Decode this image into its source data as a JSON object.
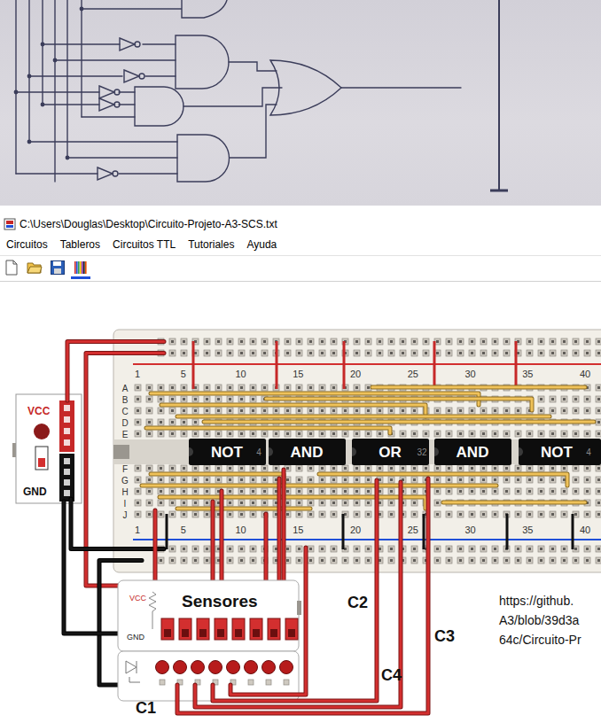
{
  "window": {
    "title": "C:\\Users\\Douglas\\Desktop\\Circuito-Projeto-A3-SCS.txt"
  },
  "menu": [
    "Circuitos",
    "Tableros",
    "Circuitos TTL",
    "Tutoriales",
    "Ayuda"
  ],
  "toolbar": [
    {
      "kind": "new",
      "selected": false
    },
    {
      "kind": "open",
      "selected": false
    },
    {
      "kind": "save",
      "selected": false
    },
    {
      "kind": "wires",
      "selected": true
    }
  ],
  "power": {
    "vcc": "VCC",
    "gnd": "GND",
    "on": true
  },
  "breadboard": {
    "column_numbers": [
      "1",
      "5",
      "10",
      "15",
      "20",
      "25",
      "30",
      "35",
      "40"
    ],
    "rows_top": [
      "A",
      "B",
      "C",
      "D",
      "E"
    ],
    "rows_bottom": [
      "F",
      "G",
      "H",
      "I",
      "J"
    ],
    "chips": [
      {
        "label": "NOT",
        "code": "4"
      },
      {
        "label": "AND"
      },
      {
        "label": "OR",
        "code": "32"
      },
      {
        "label": "AND"
      },
      {
        "label": "NOT",
        "code": "4"
      }
    ]
  },
  "sensors": {
    "title": "Sensores",
    "vcc": "VCC",
    "gnd": "GND",
    "switches": [
      {
        "on": false
      },
      {
        "on": false
      },
      {
        "on": false
      },
      {
        "on": false
      },
      {
        "on": false
      },
      {
        "on": false
      },
      {
        "on": false
      },
      {
        "on": false
      }
    ]
  },
  "leds": [
    {
      "lit": true
    },
    {
      "lit": true
    },
    {
      "lit": true
    },
    {
      "lit": true
    },
    {
      "lit": true
    },
    {
      "lit": true
    },
    {
      "lit": true
    },
    {
      "lit": true
    }
  ],
  "labels": [
    "C1",
    "C2",
    "C3",
    "C4"
  ],
  "link_lines": [
    "https://github.",
    "A3/blob/39d3a",
    "64c/Circuito-Pr"
  ]
}
